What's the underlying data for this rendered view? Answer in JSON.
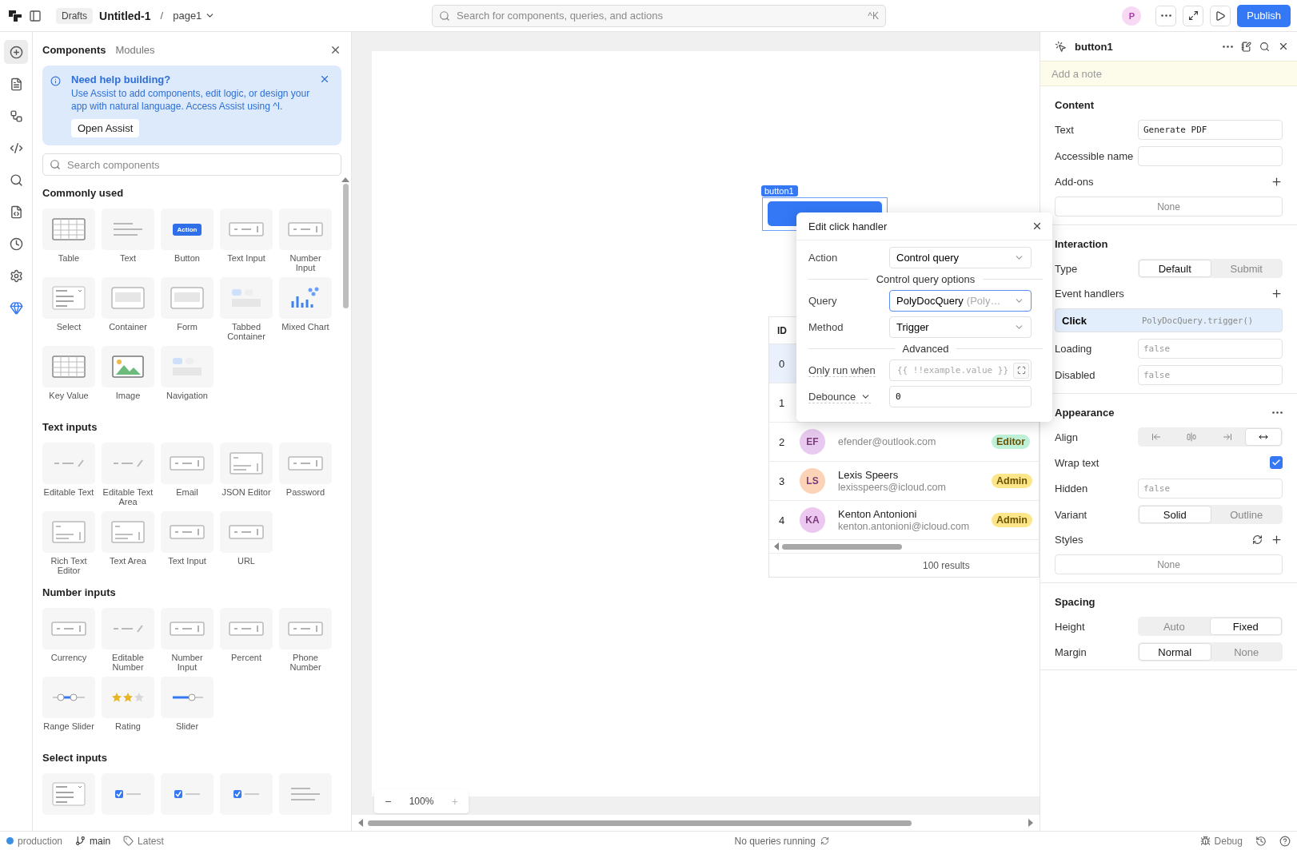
{
  "topbar": {
    "badge": "Drafts",
    "app_title": "Untitled-1",
    "separator": "/",
    "page": "page1",
    "search_placeholder": "Search for components, queries, and actions",
    "shortcut": "^K",
    "avatar": "P",
    "publish": "Publish"
  },
  "rail": [
    {
      "selected": true
    },
    {
      "selected": false
    },
    {
      "selected": false
    },
    {
      "selected": false
    },
    {
      "selected": false
    },
    {
      "selected": false
    },
    {
      "selected": false
    },
    {
      "selected": false
    },
    {
      "selected": false
    }
  ],
  "panel": {
    "tabs": [
      {
        "label": "Components",
        "selected": true
      },
      {
        "label": "Modules",
        "selected": false
      }
    ],
    "callout": {
      "title": "Need help building?",
      "body": "Use Assist to add components, edit logic, or design your app with natural language. Access Assist using ^I.",
      "button": "Open Assist"
    },
    "search_placeholder": "Search components",
    "sections": [
      {
        "title": "Commonly used",
        "items": [
          {
            "label": "Table",
            "kind": "grid"
          },
          {
            "label": "Text",
            "kind": "lines"
          },
          {
            "label": "Button",
            "kind": "button",
            "preview_text": "Action"
          },
          {
            "label": "Text Input",
            "kind": "input"
          },
          {
            "label": "Number Input",
            "kind": "input"
          },
          {
            "label": "Select",
            "kind": "list"
          },
          {
            "label": "Container",
            "kind": "panel"
          },
          {
            "label": "Form",
            "kind": "panel"
          },
          {
            "label": "Tabbed Container",
            "kind": "tabs"
          },
          {
            "label": "Mixed Chart",
            "kind": "chart"
          },
          {
            "label": "Key Value",
            "kind": "grid"
          },
          {
            "label": "Image",
            "kind": "image"
          },
          {
            "label": "Navigation",
            "kind": "tabs"
          }
        ]
      },
      {
        "title": "Text inputs",
        "items": [
          {
            "label": "Editable Text",
            "kind": "inline"
          },
          {
            "label": "Editable Text Area",
            "kind": "inline"
          },
          {
            "label": "Email",
            "kind": "input"
          },
          {
            "label": "JSON Editor",
            "kind": "area"
          },
          {
            "label": "Password",
            "kind": "input"
          },
          {
            "label": "Rich Text Editor",
            "kind": "area"
          },
          {
            "label": "Text Area",
            "kind": "area"
          },
          {
            "label": "Text Input",
            "kind": "input"
          },
          {
            "label": "URL",
            "kind": "input"
          }
        ]
      },
      {
        "title": "Number inputs",
        "items": [
          {
            "label": "Currency",
            "kind": "input"
          },
          {
            "label": "Editable Number",
            "kind": "inline"
          },
          {
            "label": "Number Input",
            "kind": "input"
          },
          {
            "label": "Percent",
            "kind": "input"
          },
          {
            "label": "Phone Number",
            "kind": "input"
          },
          {
            "label": "Range Slider",
            "kind": "range"
          },
          {
            "label": "Rating",
            "kind": "rating"
          },
          {
            "label": "Slider",
            "kind": "slider"
          }
        ]
      },
      {
        "title": "Select inputs",
        "items": [
          {
            "kind": "list"
          },
          {
            "kind": "check"
          },
          {
            "kind": "check"
          },
          {
            "kind": "check"
          },
          {
            "kind": "lines"
          }
        ]
      }
    ]
  },
  "canvas": {
    "widget_tag": "button1",
    "table": {
      "header": "ID",
      "rows": [
        {
          "id": "0",
          "selected": true
        },
        {
          "id": "1",
          "selected": false
        },
        {
          "id": "2",
          "initials": "EF",
          "email": "efender@outlook.com",
          "role": {
            "label": "Editor",
            "color": "#bff0d8"
          },
          "color": "#e8c9ef",
          "selected": false
        },
        {
          "id": "3",
          "initials": "LS",
          "name": "Lexis Speers",
          "email": "lexisspeers@icloud.com",
          "role": {
            "label": "Admin",
            "color": "#fde68a"
          },
          "color": "#fcd3b6",
          "selected": false
        },
        {
          "id": "4",
          "initials": "KA",
          "name": "Kenton Antonioni",
          "email": "kenton.antonioni@icloud.com",
          "role": {
            "label": "Admin",
            "color": "#fde68a"
          },
          "color": "#ecc8f0",
          "selected": false
        }
      ],
      "footer": "100 results"
    },
    "zoom": {
      "minus": "−",
      "value": "100%",
      "plus": "+"
    }
  },
  "popup": {
    "title": "Edit click handler",
    "rows": [
      {
        "kind": "select",
        "label": "Action",
        "value": "Control query",
        "focused": false
      },
      {
        "kind": "divider",
        "label": "Control query options"
      },
      {
        "kind": "select",
        "label": "Query",
        "value": "PolyDocQuery",
        "hint": "(Poly…",
        "focused": true
      },
      {
        "kind": "select",
        "label": "Method",
        "value": "Trigger",
        "focused": false
      },
      {
        "kind": "divider",
        "label": "Advanced"
      },
      {
        "kind": "code",
        "label": "Only run when",
        "placeholder": "{{ !!example.value }}"
      },
      {
        "kind": "number",
        "label": "Debounce",
        "value": "0"
      }
    ]
  },
  "inspector": {
    "title": "button1",
    "note_placeholder": "Add a note",
    "sections": [
      {
        "title": "Content",
        "menu": false,
        "rows": [
          {
            "kind": "field",
            "label": "Text",
            "value": "Generate PDF"
          },
          {
            "kind": "field",
            "label": "Accessible name"
          },
          {
            "kind": "header",
            "label": "Add-ons",
            "refresh": false
          },
          {
            "kind": "empty",
            "text": "None"
          }
        ]
      },
      {
        "title": "Interaction",
        "menu": false,
        "rows": [
          {
            "kind": "segmented",
            "label": "Type",
            "options": [
              {
                "label": "Default",
                "selected": true
              },
              {
                "label": "Submit",
                "selected": false
              }
            ]
          },
          {
            "kind": "header",
            "label": "Event handlers",
            "refresh": false
          },
          {
            "kind": "handler",
            "event": "Click",
            "action": "PolyDocQuery.trigger()"
          },
          {
            "kind": "field",
            "label": "Loading",
            "placeholder": "false"
          },
          {
            "kind": "field",
            "label": "Disabled",
            "placeholder": "false"
          }
        ]
      },
      {
        "title": "Appearance",
        "menu": true,
        "rows": [
          {
            "kind": "align",
            "label": "Align",
            "options": [
              {
                "selected": false
              },
              {
                "selected": false
              },
              {
                "selected": false
              },
              {
                "selected": true
              }
            ]
          },
          {
            "kind": "checkbox",
            "label": "Wrap text",
            "checked": true
          },
          {
            "kind": "field",
            "label": "Hidden",
            "placeholder": "false"
          },
          {
            "kind": "segmented",
            "label": "Variant",
            "options": [
              {
                "label": "Solid",
                "selected": true
              },
              {
                "label": "Outline",
                "selected": false
              }
            ]
          },
          {
            "kind": "header",
            "label": "Styles",
            "refresh": true
          },
          {
            "kind": "empty",
            "text": "None"
          }
        ]
      },
      {
        "title": "Spacing",
        "menu": false,
        "rows": [
          {
            "kind": "segmented",
            "label": "Height",
            "options": [
              {
                "label": "Auto",
                "selected": false
              },
              {
                "label": "Fixed",
                "selected": true
              }
            ]
          },
          {
            "kind": "segmented",
            "label": "Margin",
            "options": [
              {
                "label": "Normal",
                "selected": true
              },
              {
                "label": "None",
                "selected": false
              }
            ]
          }
        ]
      }
    ]
  },
  "statusbar": {
    "environment": "production",
    "branch": "main",
    "tag": "Latest",
    "queries": "No queries running",
    "debug": "Debug"
  }
}
